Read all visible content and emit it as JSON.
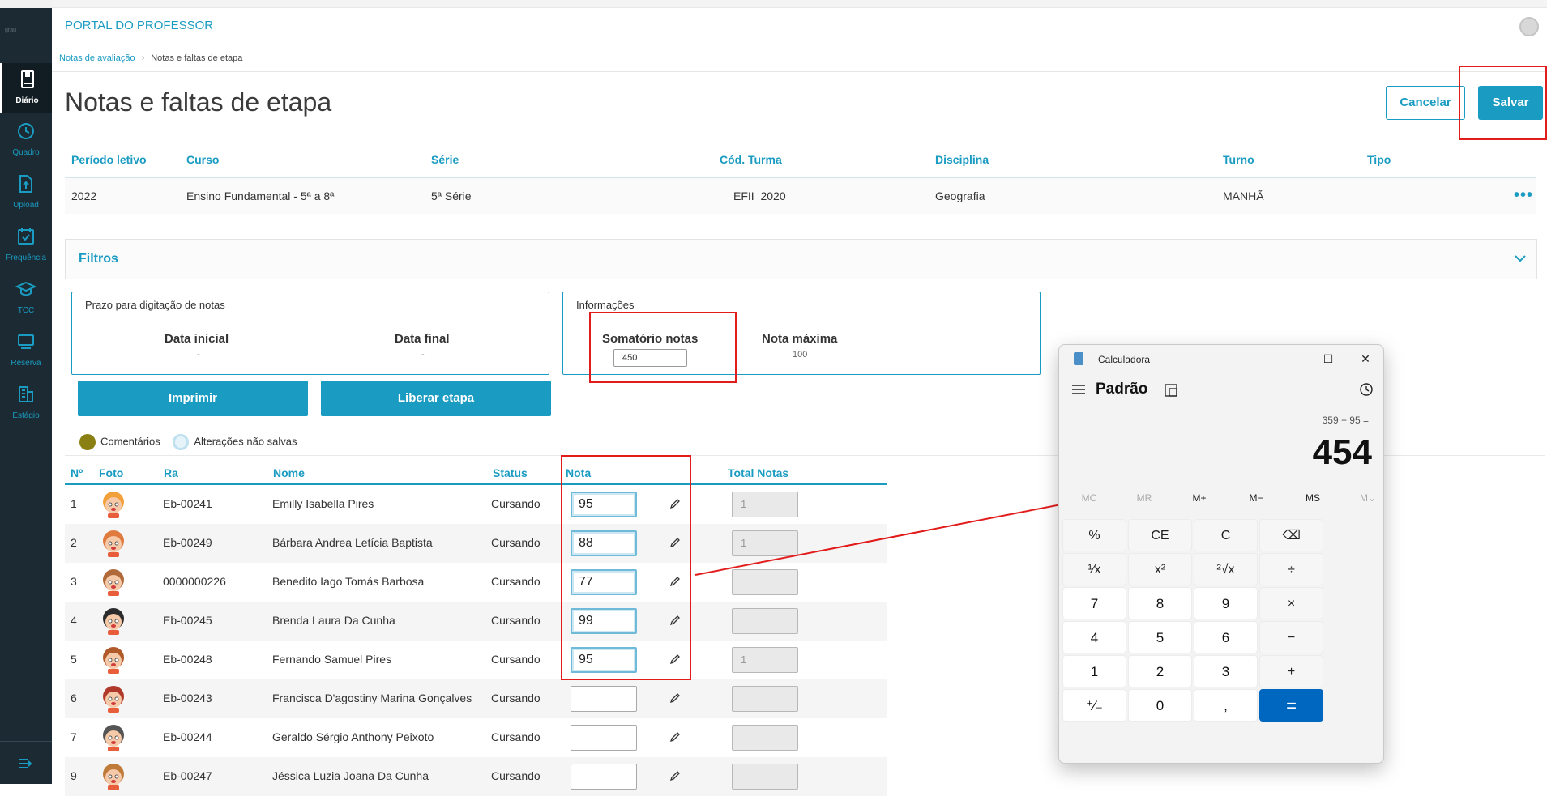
{
  "app": {
    "title": "PORTAL DO PROFESSOR",
    "brand": "grau"
  },
  "sidebar": {
    "items": [
      {
        "label": "Diário",
        "icon": "book-icon",
        "active": true
      },
      {
        "label": "Quadro",
        "icon": "clock-icon"
      },
      {
        "label": "Upload",
        "icon": "upload-icon"
      },
      {
        "label": "Frequência",
        "icon": "calendar-check-icon"
      },
      {
        "label": "TCC",
        "icon": "graduation-cap-icon"
      },
      {
        "label": "Reserva",
        "icon": "monitor-icon"
      },
      {
        "label": "Estágio",
        "icon": "building-icon"
      }
    ]
  },
  "breadcrumb": {
    "link": "Notas de avaliação",
    "current": "Notas e faltas de etapa"
  },
  "page": {
    "title": "Notas e faltas de etapa",
    "cancel_label": "Cancelar",
    "save_label": "Salvar"
  },
  "info": {
    "headers": [
      "Período letivo",
      "Curso",
      "Série",
      "Cód. Turma",
      "Disciplina",
      "Turno",
      "Tipo"
    ],
    "values": [
      "2022",
      "Ensino Fundamental - 5ª a 8ª",
      "5ª Série",
      "EFII_2020",
      "Geografia",
      "MANHÃ",
      ""
    ]
  },
  "filtros": {
    "label": "Filtros"
  },
  "prazo": {
    "title": "Prazo para digitação de notas",
    "inicial_label": "Data inicial",
    "inicial_value": "-",
    "final_label": "Data final",
    "final_value": "-"
  },
  "informacoes": {
    "title": "Informações",
    "somatorio_label": "Somatório notas",
    "somatorio_value": "450",
    "maxima_label": "Nota máxima",
    "maxima_value": "100"
  },
  "actions": {
    "imprimir": "Imprimir",
    "liberar": "Liberar etapa"
  },
  "legend": {
    "comentarios": "Comentários",
    "alteracoes": "Alterações não salvas",
    "comentarios_color": "#8a7f12",
    "alteracoes_color": "#cfe9f5"
  },
  "table": {
    "headers": {
      "num": "Nº",
      "foto": "Foto",
      "ra": "Ra",
      "nome": "Nome",
      "status": "Status",
      "nota": "Nota",
      "total": "Total Notas"
    },
    "rows": [
      {
        "num": "1",
        "ra": "Eb-00241",
        "nome": "Emilly Isabella Pires",
        "status": "Cursando",
        "nota": "95",
        "total": "1"
      },
      {
        "num": "2",
        "ra": "Eb-00249",
        "nome": "Bárbara Andrea Letícia Baptista",
        "status": "Cursando",
        "nota": "88",
        "total": "1"
      },
      {
        "num": "3",
        "ra": "0000000226",
        "nome": "Benedito Iago Tomás Barbosa",
        "status": "Cursando",
        "nota": "77",
        "total": ""
      },
      {
        "num": "4",
        "ra": "Eb-00245",
        "nome": "Brenda Laura Da Cunha",
        "status": "Cursando",
        "nota": "99",
        "total": ""
      },
      {
        "num": "5",
        "ra": "Eb-00248",
        "nome": "Fernando Samuel Pires",
        "status": "Cursando",
        "nota": "95",
        "total": "1"
      },
      {
        "num": "6",
        "ra": "Eb-00243",
        "nome": "Francisca D'agostiny Marina Gonçalves",
        "status": "Cursando",
        "nota": "",
        "total": ""
      },
      {
        "num": "7",
        "ra": "Eb-00244",
        "nome": "Geraldo Sérgio Anthony Peixoto",
        "status": "Cursando",
        "nota": "",
        "total": ""
      },
      {
        "num": "9",
        "ra": "Eb-00247",
        "nome": "Jéssica Luzia Joana Da Cunha",
        "status": "Cursando",
        "nota": "",
        "total": ""
      }
    ]
  },
  "calculator": {
    "title": "Calculadora",
    "mode": "Padrão",
    "expression": "359 + 95 =",
    "result": "454",
    "memory": [
      "MC",
      "MR",
      "M+",
      "M−",
      "MS",
      "M⌄"
    ],
    "keys": [
      [
        "%",
        "CE",
        "C",
        "⌫"
      ],
      [
        "¹⁄x",
        "x²",
        "²√x",
        "÷"
      ],
      [
        "7",
        "8",
        "9",
        "×"
      ],
      [
        "4",
        "5",
        "6",
        "−"
      ],
      [
        "1",
        "2",
        "3",
        "+"
      ],
      [
        "⁺⁄₋",
        "0",
        ",",
        "="
      ]
    ]
  }
}
